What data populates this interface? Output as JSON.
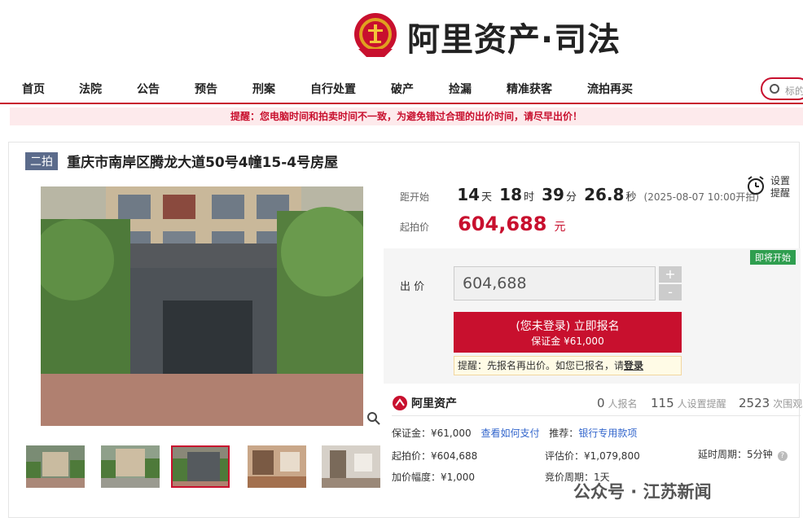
{
  "brand": {
    "title": "阿里资产·司法"
  },
  "nav": {
    "items": [
      "首页",
      "法院",
      "公告",
      "预告",
      "刑案",
      "自行处置",
      "破产",
      "捡漏",
      "精准获客",
      "流拍再买"
    ],
    "search_placeholder": "标的"
  },
  "notice": "提醒：您电脑时间和拍卖时间不一致，为避免错过合理的出价时间，请尽早出价！",
  "item": {
    "round_badge": "二拍",
    "title": "重庆市南岸区腾龙大道50号4幢15-4号房屋"
  },
  "countdown": {
    "label": "距开始",
    "days": "14",
    "days_unit": "天",
    "hours": "18",
    "hours_unit": "时",
    "minutes": "39",
    "minutes_unit": "分",
    "seconds": "26.8",
    "seconds_unit": "秒",
    "start_note": "(2025-08-07 10:00开拍)"
  },
  "alarm": {
    "line1": "设置",
    "line2": "提醒"
  },
  "start_price": {
    "label": "起拍价",
    "value": "604,688",
    "unit": "元"
  },
  "bid": {
    "ready_badge": "即将开始",
    "label": "出 价",
    "value": "604,688",
    "plus": "+",
    "minus": "-",
    "register_line1": "(您未登录) 立即报名",
    "register_line2": "保证金 ¥61,000",
    "tip_prefix": "提醒：先报名再出价。如您已报名，请",
    "tip_link": "登录"
  },
  "stats": {
    "logo_text": "阿里资产",
    "signups": "0",
    "signups_label": "人报名",
    "reminders": "115",
    "reminders_label": "人设置提醒",
    "views": "2523",
    "views_label": "次围观"
  },
  "details": {
    "deposit": "保证金：¥61,000",
    "how_to_pay": "查看如何支付",
    "recommend_label": "推荐：",
    "bank_link": "银行专用款项",
    "start_price": "起拍价：¥604,688",
    "appraisal": "评估价：¥1,079,800",
    "delay": "延时周期：5分钟",
    "increment": "加价幅度：¥1,000",
    "bid_period": "竞价周期：1天"
  },
  "watermark": "公众号 · 江苏新闻",
  "colors": {
    "accent": "#c8102e",
    "ready": "#2f9e4f",
    "badge": "#5b6b8b"
  }
}
